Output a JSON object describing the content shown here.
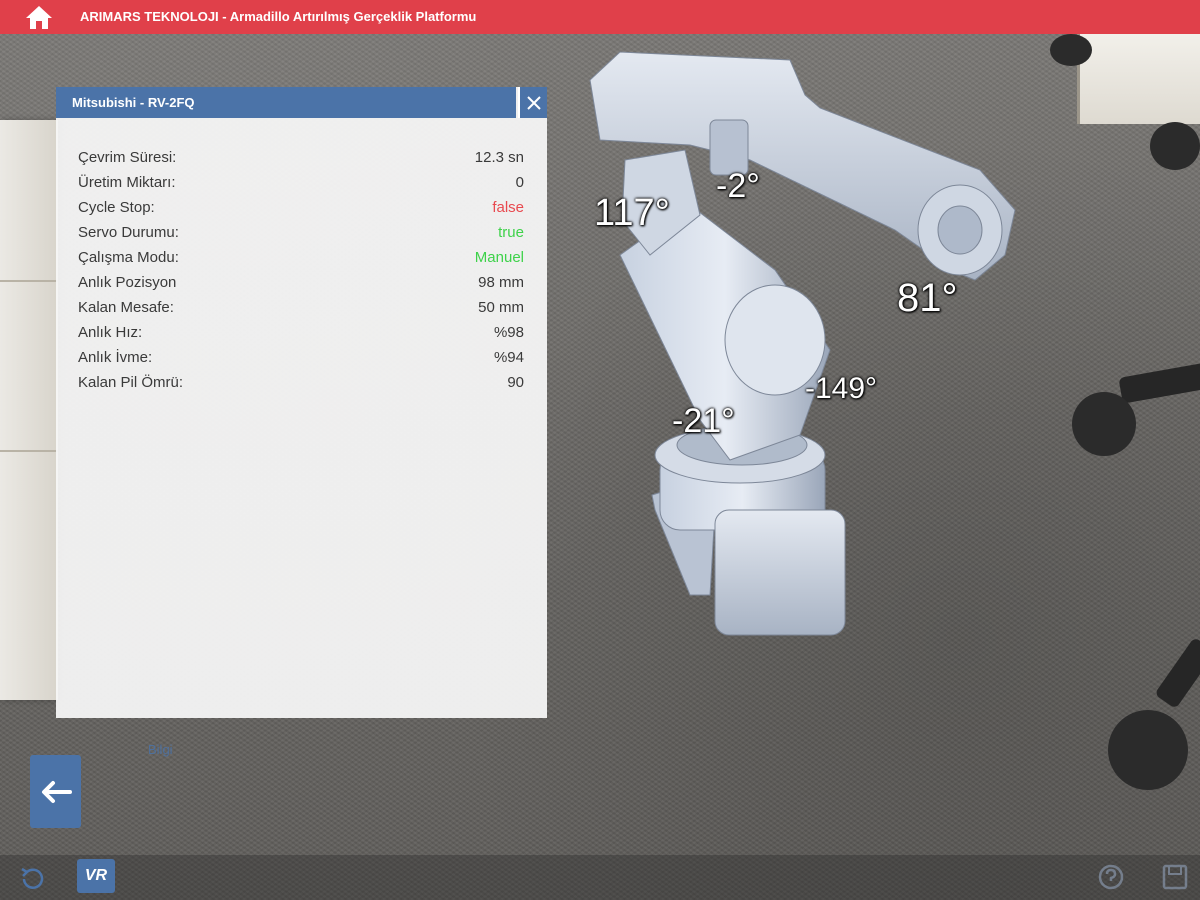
{
  "app": {
    "title": "ARIMARS TEKNOLOJI - Armadillo Artırılmış Gerçeklik Platformu",
    "accent": "#e0404a",
    "panel_color": "#4b73a8"
  },
  "panel": {
    "title": "Mitsubishi  -  RV-2FQ",
    "rows": [
      {
        "label": "Çevrim Süresi:",
        "value": "12.3 sn",
        "color": "normal"
      },
      {
        "label": "Üretim Miktarı:",
        "value": "0",
        "color": "normal"
      },
      {
        "label": "Cycle Stop:",
        "value": "false",
        "color": "red"
      },
      {
        "label": "Servo Durumu:",
        "value": "true",
        "color": "green"
      },
      {
        "label": "Çalışma Modu:",
        "value": "Manuel",
        "color": "green"
      },
      {
        "label": "Anlık Pozisyon",
        "value": "98 mm",
        "color": "normal"
      },
      {
        "label": "Kalan Mesafe:",
        "value": "50 mm",
        "color": "normal"
      },
      {
        "label": "Anlık Hız:",
        "value": "%98",
        "color": "normal"
      },
      {
        "label": "Anlık İvme:",
        "value": "%94",
        "color": "normal"
      },
      {
        "label": "Kalan Pil Ömrü:",
        "value": "90",
        "color": "normal"
      }
    ]
  },
  "robot_angles": {
    "a1": "117°",
    "a2": "-2°",
    "a3": "81°",
    "a4": "-149°",
    "a5": "-21°"
  },
  "footer": {
    "bilgi_label": "Bilgi",
    "vr_label": "VR"
  },
  "icons": [
    "home-icon",
    "close-icon",
    "back-arrow-icon",
    "reset-icon",
    "vr-icon",
    "help-icon",
    "save-icon"
  ]
}
